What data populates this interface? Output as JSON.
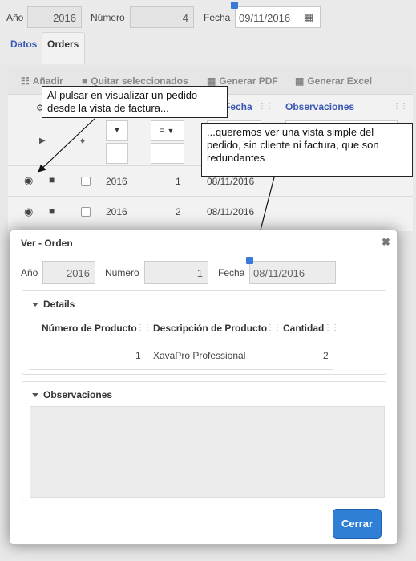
{
  "header": {
    "anio_label": "Año",
    "anio_value": "2016",
    "numero_label": "Número",
    "numero_value": "4",
    "fecha_label": "Fecha",
    "fecha_value": "09/11/2016"
  },
  "tabs": [
    {
      "label": "Datos"
    },
    {
      "label": "Orders"
    }
  ],
  "toolbar": {
    "add": "Añadir",
    "remove": "Quitar seleccionados",
    "pdf": "Generar PDF",
    "excel": "Generar Excel"
  },
  "list": {
    "col_fecha": "Fecha",
    "col_obs": "Observaciones",
    "filter_eq": "=",
    "rows": [
      {
        "anio": "2016",
        "numero": "1",
        "fecha": "08/11/2016"
      },
      {
        "anio": "2016",
        "numero": "2",
        "fecha": "08/11/2016"
      }
    ]
  },
  "callouts": {
    "left": "Al pulsar en visualizar un pedido desde la vista de factura...",
    "right": "...queremos ver una vista simple del pedido, sin cliente ni factura, que son redundantes"
  },
  "dialog": {
    "title": "Ver - Orden",
    "anio_label": "Año",
    "anio_value": "2016",
    "numero_label": "Número",
    "numero_value": "1",
    "fecha_label": "Fecha",
    "fecha_value": "08/11/2016",
    "details_title": "Details",
    "details_cols": [
      "Número de Producto",
      "Descripción de Producto",
      "Cantidad"
    ],
    "details_rows": [
      {
        "numero": "1",
        "descripcion": "XavaPro Professional",
        "cantidad": "2"
      }
    ],
    "obs_title": "Observaciones",
    "close_label": "Cerrar"
  },
  "colors": {
    "accent": "#2f7fd6",
    "tab_link": "#3a57b5"
  }
}
